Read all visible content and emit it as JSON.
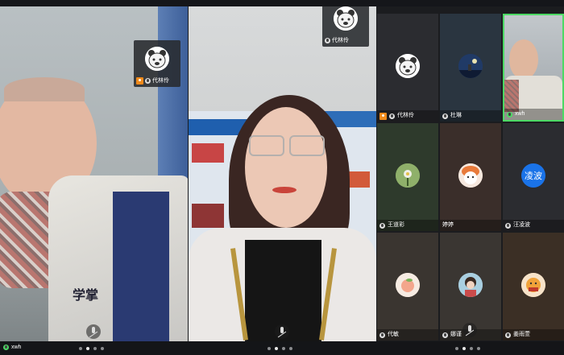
{
  "meeting": {
    "top_card_name": "代林伶",
    "left_card_name": "代林伶",
    "left_pane_name": "xwh"
  },
  "grid": {
    "tiles": [
      {
        "name": "代林伶",
        "badge": "host",
        "avatar": "bear-avatar"
      },
      {
        "name": "杜琳",
        "badge": "none",
        "avatar": "night-avatar"
      },
      {
        "name": "xwh",
        "badge": "none",
        "avatar": "video"
      },
      {
        "name": "王道彩",
        "badge": "none",
        "avatar": "flower-avatar"
      },
      {
        "name": "婷婷",
        "badge": "none",
        "avatar": "cartoon-avatar"
      },
      {
        "name": "汪凌波",
        "badge": "none",
        "avatar": "text-avatar",
        "avatar_text": "凌波"
      },
      {
        "name": "代敏",
        "badge": "none",
        "avatar": "peach-avatar"
      },
      {
        "name": "娜谨",
        "badge": "none",
        "avatar": "girl-avatar"
      },
      {
        "name": "姜雨萱",
        "badge": "none",
        "avatar": "tiger-avatar"
      }
    ]
  },
  "colors": {
    "host_badge": "#f08a1b",
    "text_avatar_bg": "#1a73e8",
    "speaking_border": "#4cd964"
  },
  "pager": {
    "pages": 4,
    "active_index": 1
  }
}
